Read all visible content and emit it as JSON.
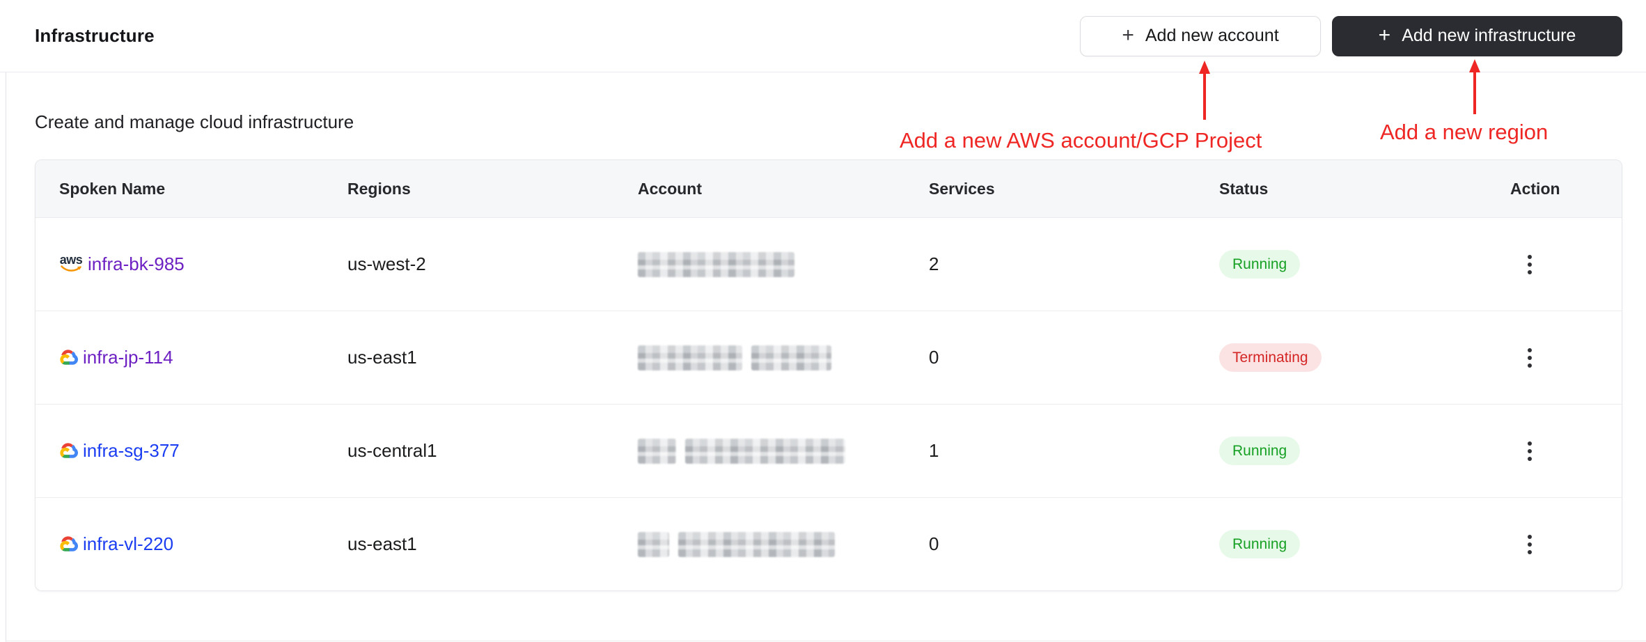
{
  "page": {
    "title": "Infrastructure",
    "subtitle": "Create and manage cloud infrastructure"
  },
  "toolbar": {
    "plus_glyph": "+",
    "add_account_label": "Add new account",
    "add_infrastructure_label": "Add new infrastructure"
  },
  "annotations": {
    "color": "#ee2724",
    "account_note": "Add a new AWS account/GCP Project",
    "region_note": "Add a new region"
  },
  "table": {
    "columns": [
      "Spoken Name",
      "Regions",
      "Account",
      "Services",
      "Status",
      "Action"
    ],
    "status_colors": {
      "running": {
        "bg": "#e7f9e8",
        "text": "#16a024"
      },
      "terminating": {
        "bg": "#fce3e3",
        "text": "#d42525"
      }
    },
    "link_colors": {
      "visited_purple": "#6d21c2",
      "blue": "#1b3df2"
    },
    "rows": [
      {
        "provider": "aws",
        "name": "infra-bk-985",
        "name_color": "#6d21c2",
        "region": "us-west-2",
        "account_redacted": true,
        "blur_segments": [
          225
        ],
        "services": "2",
        "status": "Running",
        "status_type": "running"
      },
      {
        "provider": "gcp",
        "name": "infra-jp-114",
        "name_color": "#6d21c2",
        "region": "us-east1",
        "account_redacted": true,
        "blur_segments": [
          150,
          115
        ],
        "services": "0",
        "status": "Terminating",
        "status_type": "terminating"
      },
      {
        "provider": "gcp",
        "name": "infra-sg-377",
        "name_color": "#1b3df2",
        "region": "us-central1",
        "account_redacted": true,
        "blur_segments": [
          55,
          230
        ],
        "services": "1",
        "status": "Running",
        "status_type": "running"
      },
      {
        "provider": "gcp",
        "name": "infra-vl-220",
        "name_color": "#1b3df2",
        "region": "us-east1",
        "account_redacted": true,
        "blur_segments": [
          45,
          225
        ],
        "services": "0",
        "status": "Running",
        "status_type": "running"
      }
    ]
  }
}
